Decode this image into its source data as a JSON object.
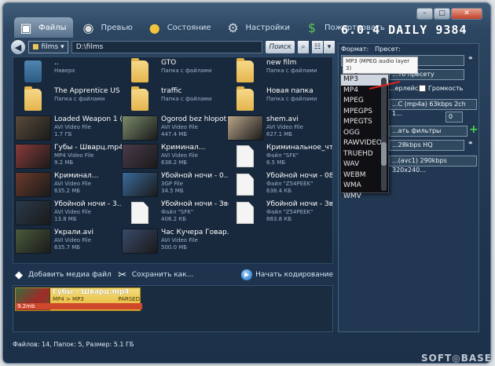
{
  "version": "6.0.4 DAILY 9384",
  "tabs": [
    {
      "label": "Файлы",
      "icon": "files-icon",
      "glyph": "▣",
      "active": true
    },
    {
      "label": "Превью",
      "icon": "film-reel-icon",
      "glyph": "◉",
      "active": false
    },
    {
      "label": "Состояние",
      "icon": "status-icon",
      "glyph": "●",
      "active": false
    },
    {
      "label": "Настройки",
      "icon": "gears-icon",
      "glyph": "⚙",
      "active": false
    },
    {
      "label": "Пожертвовать",
      "icon": "donate-icon",
      "glyph": "$",
      "active": false
    }
  ],
  "address": {
    "folder": "films",
    "path": "D:\\films",
    "search_label": "Поиск"
  },
  "files": [
    {
      "name": "..",
      "sub1": "Наверх",
      "sub2": "",
      "kind": "up"
    },
    {
      "name": "GTO",
      "sub1": "Папка с файлами",
      "sub2": "",
      "kind": "folder"
    },
    {
      "name": "new film",
      "sub1": "Папка с файлами",
      "sub2": "",
      "kind": "folder"
    },
    {
      "name": "The Apprentice US",
      "sub1": "Папка с файлами",
      "sub2": "",
      "kind": "folder"
    },
    {
      "name": "traffic",
      "sub1": "Папка с файлами",
      "sub2": "",
      "kind": "folder"
    },
    {
      "name": "Новая папка",
      "sub1": "Папка с файлами",
      "sub2": "",
      "kind": "folder"
    },
    {
      "name": "Loaded Weapon 1 (...",
      "sub1": "AVI Video File",
      "sub2": "1.7 ГБ",
      "kind": "video",
      "color": "#5a4a3a"
    },
    {
      "name": "Ogorod bez hlopot...",
      "sub1": "AVI Video File",
      "sub2": "447.4 МБ",
      "kind": "video",
      "color": "#7a8a6a"
    },
    {
      "name": "shem.avi",
      "sub1": "AVI Video File",
      "sub2": "627.1 МБ",
      "kind": "video",
      "color": "#b8a58a"
    },
    {
      "name": "Губы - Шварц.mp4",
      "sub1": "MP4 Video File",
      "sub2": "9.2 МБ",
      "kind": "video",
      "color": "#8a3a3a"
    },
    {
      "name": "Криминал...",
      "sub1": "AVI Video File",
      "sub2": "638.2 МБ",
      "kind": "video",
      "color": "#4a3a4a"
    },
    {
      "name": "Криминальное_чтив...",
      "sub1": "Файл \"SFK\"",
      "sub2": "6.5 МБ",
      "kind": "doc"
    },
    {
      "name": "Криминал...",
      "sub1": "AVI Video File",
      "sub2": "635.2 МБ",
      "kind": "video",
      "color": "#6a3a2a"
    },
    {
      "name": "Убойной ночи - 0...",
      "sub1": "3GP File",
      "sub2": "34.5 МБ",
      "kind": "video",
      "color": "#3a6a9a"
    },
    {
      "name": "Убойной ночи - 08.3...",
      "sub1": "Файл \"Z54PEEK\"",
      "sub2": "638.4 КБ",
      "kind": "doc"
    },
    {
      "name": "Убойной ночи - 3...",
      "sub1": "AVI Video File",
      "sub2": "13.8 МБ",
      "kind": "video",
      "color": "#2a3a4a"
    },
    {
      "name": "Убойной ночи - Звёз...",
      "sub1": "Файл \"SFK\"",
      "sub2": "406.2 КБ",
      "kind": "doc"
    },
    {
      "name": "Убойной ночи - Звёз...",
      "sub1": "Файл \"Z54PEEK\"",
      "sub2": "883.8 КБ",
      "kind": "doc"
    },
    {
      "name": "Украли.avi",
      "sub1": "AVI Video File",
      "sub2": "635.7 МБ",
      "kind": "video",
      "color": "#4a5a3a"
    },
    {
      "name": "Час Кучера Говар...",
      "sub1": "AVI Video File",
      "sub2": "500.0 МБ",
      "kind": "video",
      "color": "#3a4a6a"
    }
  ],
  "actions": {
    "add_media": "Добавить медиа файл",
    "save": "Сохранить как...",
    "encode": "Начать кодирование"
  },
  "queue": [
    {
      "name": "Губы - Шварц.mp4",
      "conv": "MP4 > MP3",
      "state": "PARSED",
      "size": "9.2mb"
    }
  ],
  "status": "Файлов: 14, Папок: 5, Размер: 5.1 ГБ",
  "right": {
    "format_label": "Формат:",
    "preset_label": "Пресет:",
    "preset_value": "...то пресету",
    "interlace_label": "...ерлейс",
    "volume_label": "Громкость",
    "audio_track": "...C (mp4a) 63kbps 2ch 1...",
    "track_num": "0",
    "filters_label": "...ать фильтры",
    "audio_quality": "...28kbps HQ",
    "video_track": "...(avc1) 290kbps 320x240..."
  },
  "tooltip": {
    "line1": "MP3 (MPEG audio layer 3)",
    "line2": "mp3"
  },
  "formats": [
    "MP3",
    "MP4",
    "MPEG",
    "MPEGPS",
    "MPEGTS",
    "OGG",
    "RAWVIDEO",
    "TRUEHD",
    "WAV",
    "WEBM",
    "WMA",
    "WMV"
  ],
  "selected_format": "MP3",
  "watermark": "SOFT◎BASE"
}
